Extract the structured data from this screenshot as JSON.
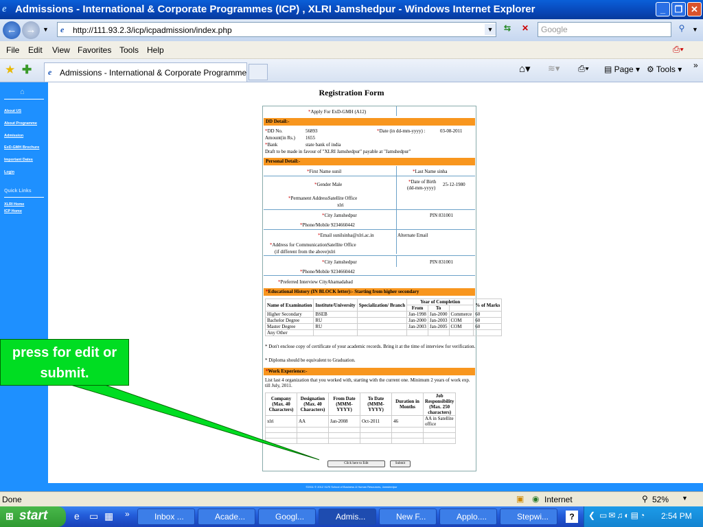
{
  "window": {
    "title": "Admissions - International & Corporate Programmes (ICP) , XLRI Jamshedpur - Windows Internet Explorer"
  },
  "address": {
    "url": "http://111.93.2.3/icp/icpadmission/index.php",
    "search_placeholder": "Google"
  },
  "menu": [
    "File",
    "Edit",
    "View",
    "Favorites",
    "Tools",
    "Help"
  ],
  "tab": {
    "label": "Admissions - International & Corporate Programmes (I..."
  },
  "toolbar": {
    "page": "Page",
    "tools": "Tools"
  },
  "sidebar": {
    "links": [
      "About US",
      "About Programme",
      "Admission",
      "ExD-GMH Brochure",
      "Important Dates",
      "Login"
    ],
    "quick_title": "Quick Links",
    "quick_links": [
      "XLRI Home",
      "ICP Home"
    ]
  },
  "form": {
    "title": "Registration Form",
    "apply_for": "Apply For ExD-GMH (A12)",
    "dd_header": "DD Detail:-",
    "dd_no_label": "DD No.",
    "dd_no": "56893",
    "date_label": "Date (in dd-mm-yyyy) :",
    "date": "03-08-2011",
    "amount_label": "Amount(in Rs.)",
    "amount": "1655",
    "bank_label": "Bank",
    "bank": "state bank of india",
    "draft_note": "Draft to be made in favour of \"XLRI Jamshedpur\" payable at \"Jamshedpur\"",
    "personal_header": "Personal Detail:-",
    "first_name": "First Name sunil",
    "last_name": "Last Name sinha",
    "gender": "Gender Male",
    "dob_label": "Date of Birth",
    "dob_fmt": "(dd-mm-yyyy)",
    "dob": "25-12-1980",
    "perm_addr": "Permanent AddressSatellite Office",
    "perm_addr2": "xlri",
    "city": "City Jamshedpur",
    "pin": "PIN  831001",
    "phone": "Phone/Mobile 9234660442",
    "email": "Email sunilsinha@xlri.ac.in",
    "alt_email": "Alternate Email",
    "comm_addr": "Address for CommunicationSatellite Office",
    "comm_addr2": "(if different from the above)xlri",
    "city2": "City Jamshedpur",
    "pin2": "PIN  831001",
    "phone2": "Phone/Mobile 9234660442",
    "interview": "Preferred Interview CityAhamadabad",
    "edu_header": "Educational History (IN BLOCK letter):- Starting from higher secondary",
    "edu_cols": [
      "Name of Examination",
      "Institute/University",
      "Specialization/ Branch",
      "From",
      "To",
      "",
      "% of Marks"
    ],
    "edu_year_head": "Year of Completion",
    "edu_rows": [
      [
        "Higher Secondary",
        "BSEB",
        "",
        "Jan-1998",
        "Jan-2000",
        "Commerce",
        "60"
      ],
      [
        "Bachelor Degree",
        "RU",
        "",
        "Jan-2000",
        "Jan-2003",
        "COM",
        "60"
      ],
      [
        "Master Degree",
        "RU",
        "",
        "Jan-2003",
        "Jan-2005",
        "COM",
        "60"
      ],
      [
        "Any Other",
        "",
        "",
        "",
        "",
        "",
        ""
      ]
    ],
    "edu_note1": "* Don't enclose copy of certificate of your academic records. Bring it at the time of interview for verification.",
    "edu_note2": "* Diploma should be equivalent to Graduation.",
    "work_header": "Work Experience:-",
    "work_note": "List last 4 organization that you worked with, starting with the current one. Minimum 2 years of work exp. till July, 2011.",
    "work_cols": [
      "Company (Max. 40 Characters)",
      "Designation (Max. 40 Characters)",
      "From Date (MMM-YYYY)",
      "To Date (MMM-YYYY)",
      "Duration in Months",
      "Job Responsibility (Max. 250 characters)"
    ],
    "work_rows": [
      [
        "xlri",
        "AA",
        "Jan-2008",
        "Oct-2011",
        "46",
        "AA in Satellite office"
      ],
      [
        "",
        "",
        "",
        "",
        "",
        ""
      ],
      [
        "",
        "",
        "",
        "",
        "",
        ""
      ],
      [
        "",
        "",
        "",
        "",
        "",
        ""
      ]
    ],
    "edit_btn": "Click here to Edit",
    "submit_btn": "Submit"
  },
  "footer": "©2011 © 2012 XLRI School of Business & Human Resources, Jamshedpur",
  "callout": {
    "text": "press for edit or submit."
  },
  "status": {
    "text": "Done",
    "zone": "Internet",
    "zoom": "52%"
  },
  "taskbar": {
    "start": "start",
    "tasks": [
      "Inbox ...",
      "Acade...",
      "Googl...",
      "Admis...",
      "New F...",
      "Applo....",
      "Stepwi..."
    ],
    "clock": "2:54 PM"
  }
}
